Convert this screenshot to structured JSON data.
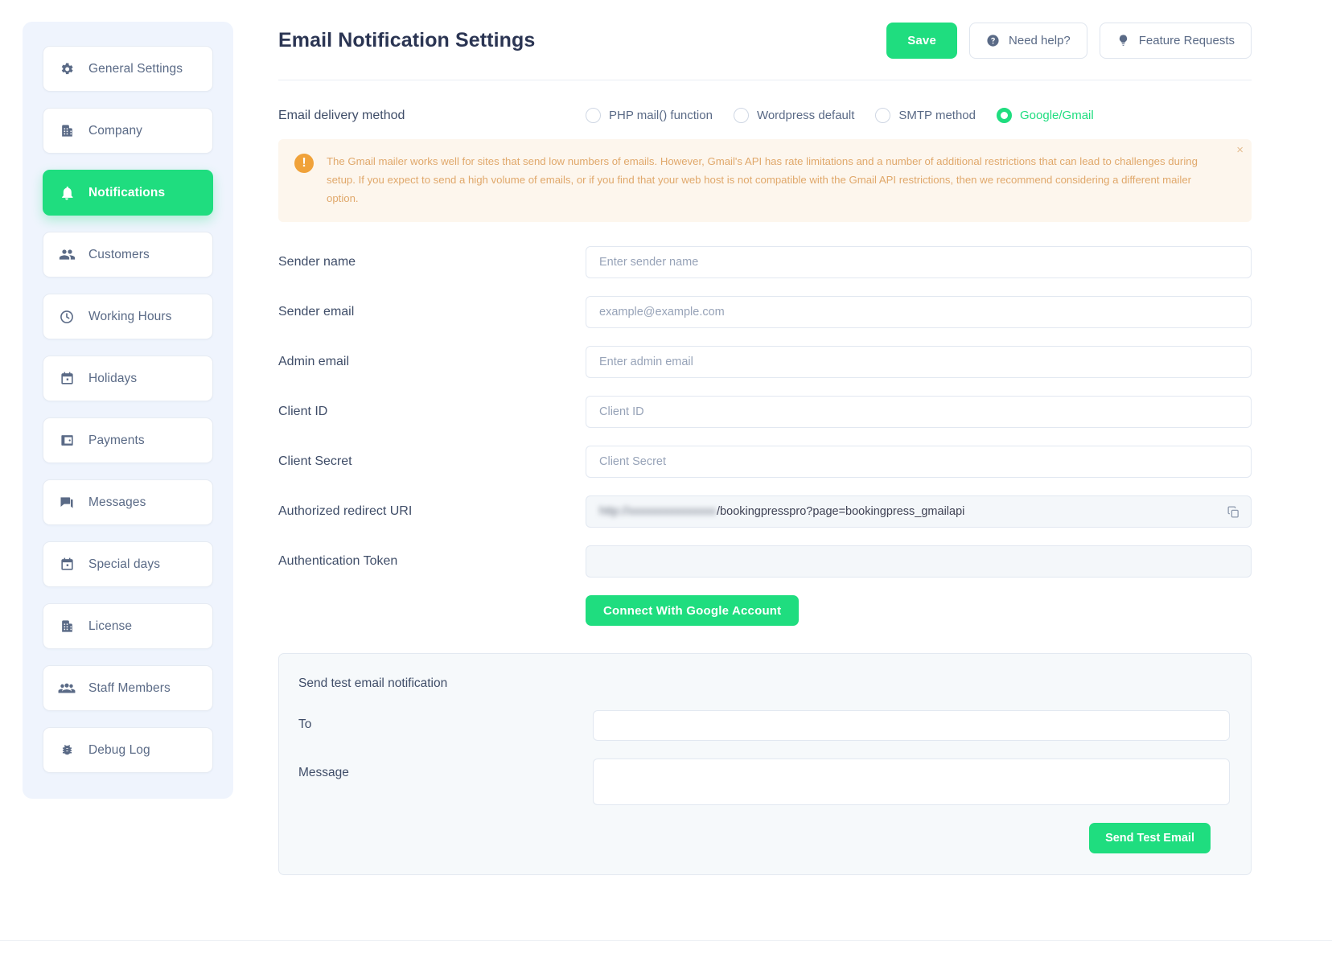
{
  "sidebar": {
    "items": [
      {
        "label": "General Settings",
        "icon": "gear-icon",
        "active": false
      },
      {
        "label": "Company",
        "icon": "building-icon",
        "active": false
      },
      {
        "label": "Notifications",
        "icon": "bell-icon",
        "active": true
      },
      {
        "label": "Customers",
        "icon": "users-icon",
        "active": false
      },
      {
        "label": "Working Hours",
        "icon": "clock-icon",
        "active": false
      },
      {
        "label": "Holidays",
        "icon": "calendar-icon",
        "active": false
      },
      {
        "label": "Payments",
        "icon": "wallet-icon",
        "active": false
      },
      {
        "label": "Messages",
        "icon": "chat-icon",
        "active": false
      },
      {
        "label": "Special days",
        "icon": "calendar-icon",
        "active": false
      },
      {
        "label": "License",
        "icon": "building-icon",
        "active": false
      },
      {
        "label": "Staff Members",
        "icon": "staff-icon",
        "active": false
      },
      {
        "label": "Debug Log",
        "icon": "bug-icon",
        "active": false
      }
    ]
  },
  "header": {
    "title": "Email Notification Settings",
    "save_label": "Save",
    "need_help_label": "Need help?",
    "feature_requests_label": "Feature Requests"
  },
  "delivery": {
    "label": "Email delivery method",
    "options": [
      {
        "label": "PHP mail() function",
        "selected": false
      },
      {
        "label": "Wordpress default",
        "selected": false
      },
      {
        "label": "SMTP method",
        "selected": false
      },
      {
        "label": "Google/Gmail",
        "selected": true
      }
    ]
  },
  "notice": {
    "text": "The Gmail mailer works well for sites that send low numbers of emails. However, Gmail's API has rate limitations and a number of additional restrictions that can lead to challenges during setup. If you expect to send a high volume of emails, or if you find that your web host is not compatible with the Gmail API restrictions, then we recommend considering a different mailer option.",
    "close_label": "×"
  },
  "form": {
    "sender_name": {
      "label": "Sender name",
      "placeholder": "Enter sender name",
      "value": ""
    },
    "sender_email": {
      "label": "Sender email",
      "placeholder": "example@example.com",
      "value": ""
    },
    "admin_email": {
      "label": "Admin email",
      "placeholder": "Enter admin email",
      "value": ""
    },
    "client_id": {
      "label": "Client ID",
      "placeholder": "Client ID",
      "value": ""
    },
    "client_secret": {
      "label": "Client Secret",
      "placeholder": "Client Secret",
      "value": ""
    },
    "redirect_uri": {
      "label": "Authorized redirect URI",
      "masked_prefix": "http://xxxxxxxxxxxxxxx",
      "value": "/bookingpresspro?page=bookingpress_gmailapi"
    },
    "auth_token": {
      "label": "Authentication Token",
      "value": ""
    },
    "connect_label": "Connect With Google Account"
  },
  "test": {
    "title": "Send test email notification",
    "to_label": "To",
    "to_value": "",
    "message_label": "Message",
    "message_value": "",
    "send_label": "Send Test Email"
  },
  "colors": {
    "accent": "#1fdd7f",
    "sidebar_bg": "#eff4fd",
    "notice_bg": "#fdf6ed",
    "notice_text": "#e0a86b",
    "warn_icon": "#f0a23a",
    "text_dark": "#2b3553",
    "text_muted": "#5a6a86"
  }
}
